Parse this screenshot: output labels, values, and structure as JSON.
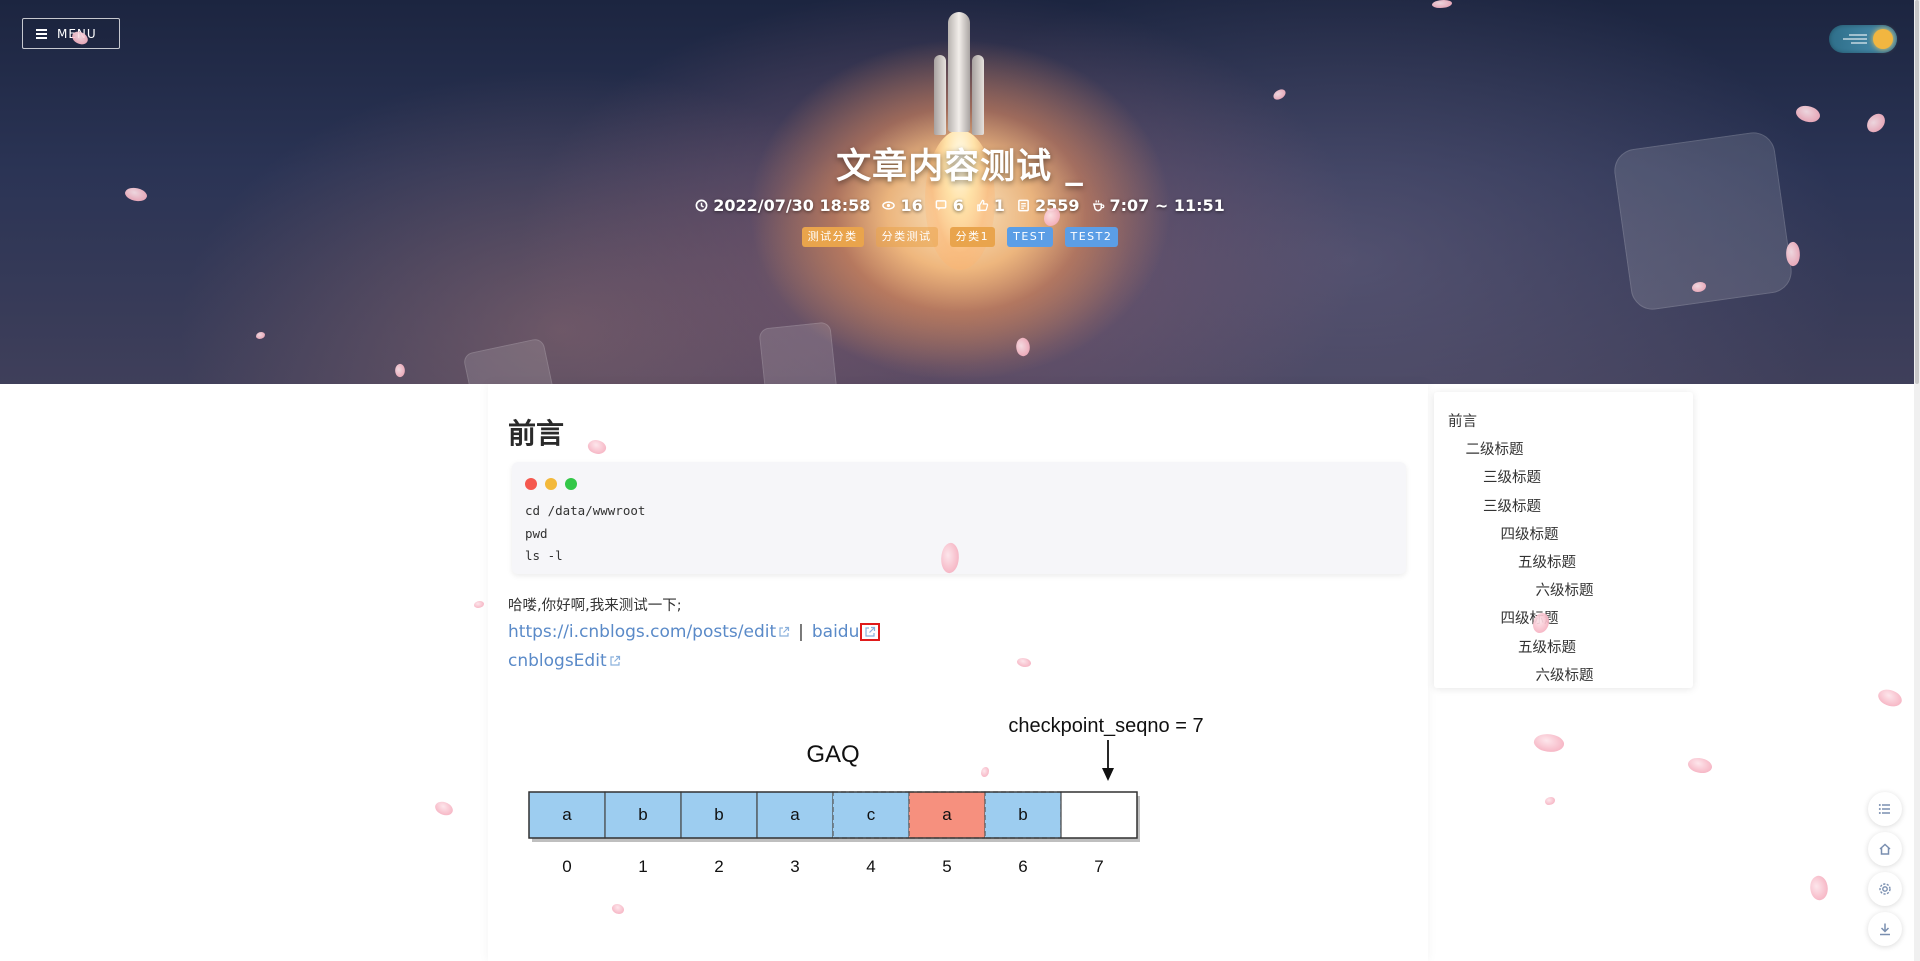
{
  "hero": {
    "title": "文章内容测试 _",
    "meta": {
      "date": "2022/07/30 18:58",
      "views": "16",
      "comments": "6",
      "likes": "1",
      "words": "2559",
      "read_time": "7:07 ~ 11:51"
    },
    "categories": [
      "测试分类",
      "分类测试",
      "分类1"
    ],
    "tags": [
      "TEST",
      "TEST2"
    ]
  },
  "menu": {
    "label": "MENU"
  },
  "article": {
    "heading": "前言",
    "code_lines": [
      "cd /data/wwwroot",
      "pwd",
      "ls -l"
    ],
    "paragraph": "哈喽,你好啊,我来测试一下;",
    "links": [
      {
        "text": "https://i.cnblogs.com/posts/edit"
      },
      {
        "text": "baidu"
      },
      {
        "text": "cnblogsEdit"
      }
    ],
    "link_separator": "|"
  },
  "diagram": {
    "title": "GAQ",
    "pointer_label": "checkpoint_seqno = 7",
    "cells": [
      {
        "value": "a",
        "index": "0",
        "state": "filled"
      },
      {
        "value": "b",
        "index": "1",
        "state": "filled"
      },
      {
        "value": "b",
        "index": "2",
        "state": "filled"
      },
      {
        "value": "a",
        "index": "3",
        "state": "filled"
      },
      {
        "value": "c",
        "index": "4",
        "state": "dashed"
      },
      {
        "value": "a",
        "index": "5",
        "state": "highlight"
      },
      {
        "value": "b",
        "index": "6",
        "state": "dashed"
      },
      {
        "value": "",
        "index": "7",
        "state": "empty"
      }
    ],
    "colors": {
      "filled": "#9dcdf0",
      "highlight": "#f6907e",
      "empty": "#ffffff"
    }
  },
  "toc": {
    "items": [
      {
        "label": "前言",
        "level": 1
      },
      {
        "label": "二级标题",
        "level": 2
      },
      {
        "label": "三级标题",
        "level": 3
      },
      {
        "label": "三级标题",
        "level": 3
      },
      {
        "label": "四级标题",
        "level": 4
      },
      {
        "label": "五级标题",
        "level": 5
      },
      {
        "label": "六级标题",
        "level": 6
      },
      {
        "label": "四级标题",
        "level": 4
      },
      {
        "label": "五级标题",
        "level": 5
      },
      {
        "label": "六级标题",
        "level": 6
      }
    ]
  },
  "floating_buttons": [
    {
      "icon": "list-icon"
    },
    {
      "icon": "home-icon"
    },
    {
      "icon": "gear-icon"
    },
    {
      "icon": "download-icon"
    }
  ],
  "theme": {
    "accent": "#5a8ac8",
    "category_color": "#e9a44c",
    "tag_color": "#5b9ee6"
  }
}
